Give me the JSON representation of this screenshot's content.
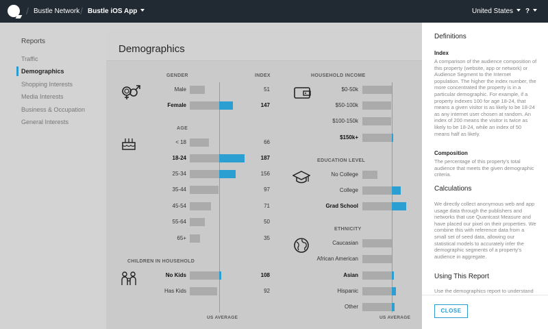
{
  "topbar": {
    "network": "Bustle Network",
    "app": "Bustle iOS App",
    "country": "United States",
    "help": "?"
  },
  "sidebar": {
    "title": "Reports",
    "items": [
      {
        "label": "Traffic"
      },
      {
        "label": "Demographics"
      },
      {
        "label": "Shopping Interests"
      },
      {
        "label": "Media Interests"
      },
      {
        "label": "Business & Occupation"
      },
      {
        "label": "General Interests"
      }
    ]
  },
  "main": {
    "title": "Demographics",
    "index_header": "INDEX",
    "us_average": "US AVERAGE",
    "gender": {
      "title": "GENDER",
      "rows": [
        {
          "label": "Male",
          "index": "51",
          "value": 51,
          "bold": false
        },
        {
          "label": "Female",
          "index": "147",
          "value": 147,
          "bold": true
        }
      ]
    },
    "age": {
      "title": "AGE",
      "rows": [
        {
          "label": "< 18",
          "index": "66",
          "value": 66,
          "bold": false
        },
        {
          "label": "18-24",
          "index": "187",
          "value": 187,
          "bold": true
        },
        {
          "label": "25-34",
          "index": "156",
          "value": 156,
          "bold": false
        },
        {
          "label": "35-44",
          "index": "97",
          "value": 97,
          "bold": false
        },
        {
          "label": "45-54",
          "index": "71",
          "value": 71,
          "bold": false
        },
        {
          "label": "55-64",
          "index": "50",
          "value": 50,
          "bold": false
        },
        {
          "label": "65+",
          "index": "35",
          "value": 35,
          "bold": false
        }
      ]
    },
    "children": {
      "title": "CHILDREN IN HOUSEHOLD",
      "rows": [
        {
          "label": "No Kids",
          "index": "108",
          "value": 108,
          "bold": true
        },
        {
          "label": "Has Kids",
          "index": "92",
          "value": 92,
          "bold": false
        }
      ]
    },
    "income": {
      "title": "HOUSEHOLD INCOME",
      "rows": [
        {
          "label": "$0-50k",
          "value": 100,
          "bold": false
        },
        {
          "label": "$50-100k",
          "value": 98,
          "bold": false
        },
        {
          "label": "$100-150k",
          "value": 97,
          "bold": false
        },
        {
          "label": "$150k+",
          "value": 105,
          "bold": true
        }
      ]
    },
    "education": {
      "title": "EDUCATION LEVEL",
      "rows": [
        {
          "label": "No College",
          "value": 52,
          "bold": false
        },
        {
          "label": "College",
          "value": 130,
          "bold": false
        },
        {
          "label": "Grad School",
          "value": 148,
          "bold": true
        }
      ]
    },
    "ethnicity": {
      "title": "ETHNICITY",
      "rows": [
        {
          "label": "Caucasian",
          "value": 100,
          "bold": false
        },
        {
          "label": "African American",
          "value": 100,
          "bold": false
        },
        {
          "label": "Asian",
          "value": 108,
          "bold": true
        },
        {
          "label": "Hispanic",
          "value": 113,
          "bold": false
        },
        {
          "label": "Other",
          "value": 110,
          "bold": false
        }
      ]
    }
  },
  "panel": {
    "title": "Definitions",
    "index_h": "Index",
    "index_text": "A comparison of the audience composition of this property (website, app or network) or Audience Segment to the Internet population. The higher the index number, the more concentrated the property is in a particular demographic. For example, if a property indexes 100 for age 18-24, that means a given visitor is as likely to be 18-24 as any internet user chosen at random. An index of 200 means the visitor is twice as likely to be 18-24, while an index of 50 means half as likely.",
    "comp_h": "Composition",
    "comp_text": "The percentage of this property's total audience that meets the given demographic criteria.",
    "calc_title": "Calculations",
    "calc_text": "We directly collect anonymous web and app usage data through the publishers and networks that use Quantcast Measure and have placed our pixel on their properties. We combine this with reference data from a small set of seed data, allowing our statistical models to accurately infer the demographic segments of a property's audience in aggregate.",
    "using_title": "Using This Report",
    "using_text": "Use the demographics report to understand what the demographic",
    "close": "CLOSE"
  },
  "colors": {
    "accent": "#2b9fd2",
    "topbar": "#212a33",
    "bar": "#ababab"
  }
}
